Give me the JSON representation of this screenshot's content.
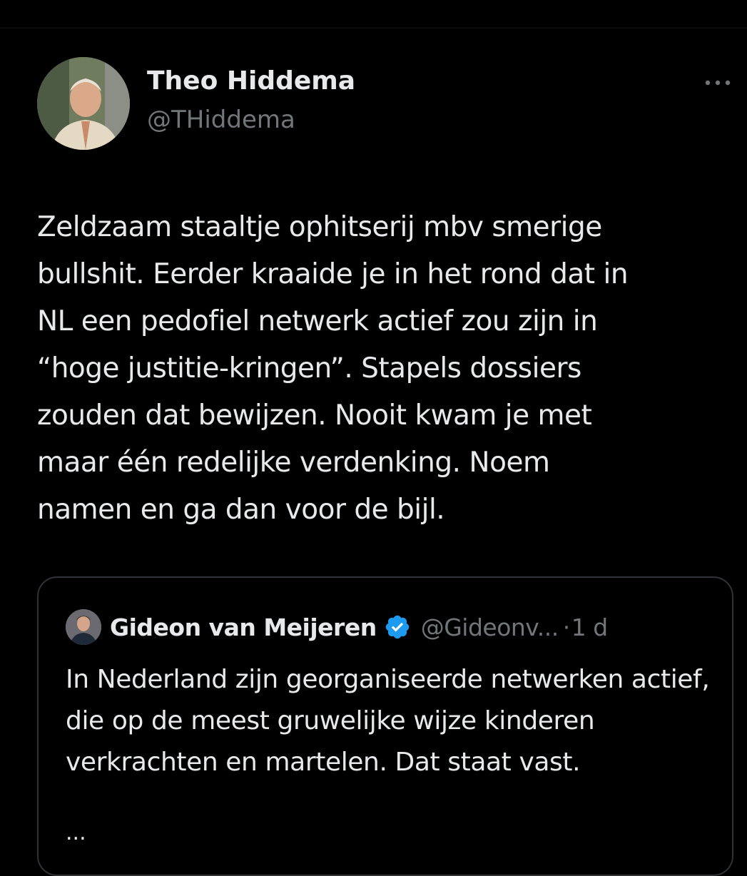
{
  "tweet": {
    "author_name": "Theo Hiddema",
    "author_handle": "@THiddema",
    "more_icon": "more-horizontal-icon",
    "text": "Zeldzaam staaltje ophitserij mbv smerige\nbullshit. Eerder kraaide je in het rond dat in\nNL een pedofiel netwerk actief zou zijn in\n“hoge justitie-kringen”. Stapels dossiers\nzouden dat bewijzen. Nooit kwam je met\nmaar één redelijke verdenking. Noem\nnamen en ga dan voor de bijl."
  },
  "quote": {
    "author_name": "Gideon van Meijeren",
    "verified_icon": "verified-badge-icon",
    "author_handle": "@Gideonv...",
    "separator": "·",
    "time": "1 d",
    "text": "In Nederland zijn georganiseerde netwerken actief, die op de meest gruwelijke wijze kinderen verkrachten en martelen. Dat staat vast.",
    "ellipsis": "..."
  },
  "colors": {
    "background": "#000000",
    "text_primary": "#e7e9ea",
    "text_secondary": "#71767b",
    "border": "#2f3336",
    "verified": "#1d9bf0"
  }
}
